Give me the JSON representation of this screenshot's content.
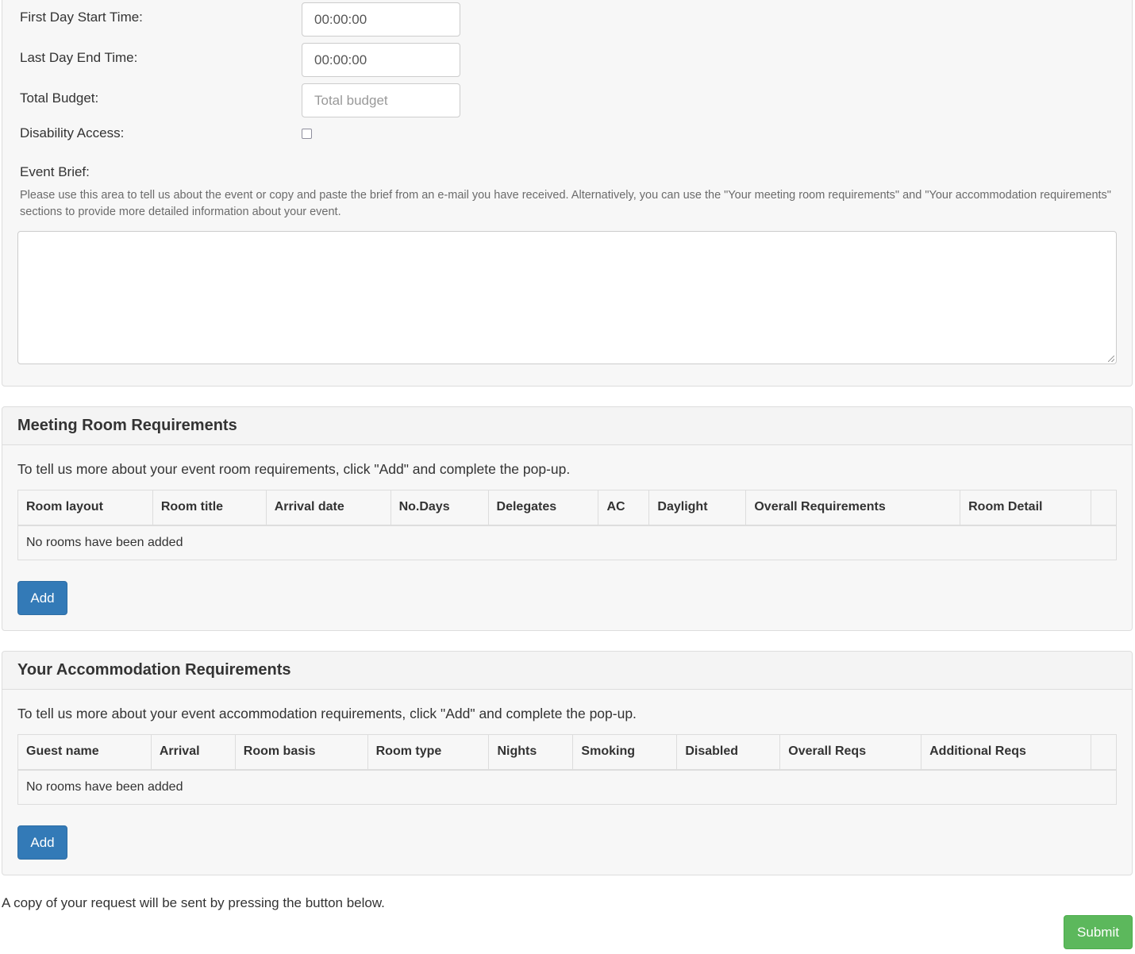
{
  "event_details": {
    "first_day_start_time": {
      "label": "First Day Start Time:",
      "value": "00:00:00"
    },
    "last_day_end_time": {
      "label": "Last Day End Time:",
      "value": "00:00:00"
    },
    "total_budget": {
      "label": "Total Budget:",
      "value": "",
      "placeholder": "Total budget"
    },
    "disability_access": {
      "label": "Disability Access:",
      "checked": false
    },
    "event_brief": {
      "label": "Event Brief:",
      "help": "Please use this area to tell us about the event or copy and paste the brief from an e-mail you have received. Alternatively, you can use the \"Your meeting room requirements\" and \"Your accommodation requirements\" sections to provide more detailed information about your event.",
      "value": ""
    }
  },
  "meeting_rooms": {
    "title": "Meeting Room Requirements",
    "intro": "To tell us more about your event room requirements, click \"Add\" and complete the pop-up.",
    "columns": [
      "Room layout",
      "Room title",
      "Arrival date",
      "No.Days",
      "Delegates",
      "AC",
      "Daylight",
      "Overall Requirements",
      "Room Detail",
      ""
    ],
    "empty_text": "No rooms have been added",
    "add_label": "Add"
  },
  "accommodation": {
    "title": "Your Accommodation Requirements",
    "intro": "To tell us more about your event accommodation requirements, click \"Add\" and complete the pop-up.",
    "columns": [
      "Guest name",
      "Arrival",
      "Room basis",
      "Room type",
      "Nights",
      "Smoking",
      "Disabled",
      "Overall Reqs",
      "Additional Reqs",
      ""
    ],
    "empty_text": "No rooms have been added",
    "add_label": "Add"
  },
  "footer": {
    "note": "A copy of your request will be sent by pressing the button below.",
    "submit_label": "Submit"
  },
  "colors": {
    "primary": "#337ab7",
    "success": "#5cb85c",
    "panel_bg": "#f7f7f7",
    "border": "#dddddd"
  }
}
